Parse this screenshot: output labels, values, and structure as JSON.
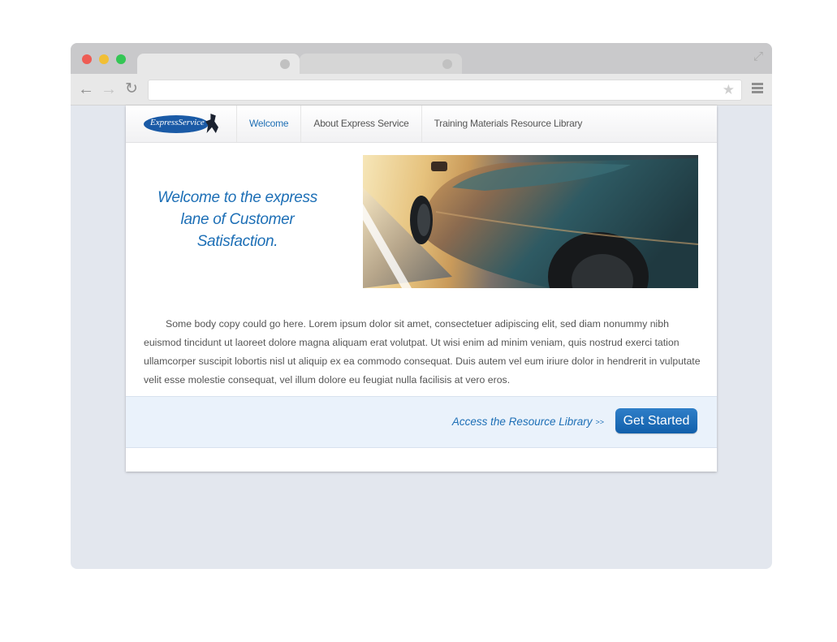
{
  "site": {
    "logo_text": "ExpressService",
    "nav": [
      {
        "label": "Welcome",
        "active": true
      },
      {
        "label": "About Express Service",
        "active": false
      },
      {
        "label": "Training Materials Resource Library",
        "active": false
      }
    ]
  },
  "hero": {
    "headline_line1": "Welcome to the express",
    "headline_line2": "lane of Customer Satisfaction."
  },
  "body_copy": "Some body copy could go here. Lorem ipsum dolor sit amet, consectetuer adipiscing elit, sed diam nonummy nibh euismod tincidunt ut laoreet dolore magna aliquam erat volutpat. Ut wisi enim ad minim veniam, quis nostrud exerci tation ullamcorper suscipit lobortis nisl ut aliquip ex ea commodo consequat. Duis autem vel eum iriure dolor in hendrerit in vulputate velit esse molestie consequat, vel illum dolore eu feugiat nulla facilisis at vero eros.",
  "cta": {
    "link_label": "Access the Resource Library",
    "link_arrows": ">>",
    "button_label": "Get Started"
  },
  "colors": {
    "brand_blue": "#1d6fb6",
    "cta_background": "#eaf2fb",
    "browser_frame": "#c9c9cb"
  }
}
